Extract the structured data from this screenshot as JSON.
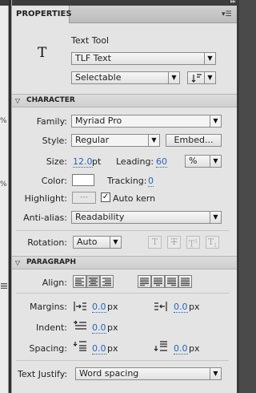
{
  "left_dock": {
    "pct1": "%",
    "pct2": "%"
  },
  "panel": {
    "tab_label": "PROPERTIES",
    "menu_icon": "panel-menu-icon"
  },
  "tool": {
    "glyph": "T",
    "name": "Text Tool",
    "text_type": "TLF Text",
    "selectability": "Selectable"
  },
  "character": {
    "title": "CHARACTER",
    "family_label": "Family:",
    "family_value": "Myriad Pro",
    "style_label": "Style:",
    "style_value": "Regular",
    "embed_label": "Embed...",
    "size_label": "Size:",
    "size_value": "12.0",
    "size_unit": "pt",
    "leading_label": "Leading:",
    "leading_value": "60",
    "leading_unit": "%",
    "color_label": "Color:",
    "color_value": "#ffffff",
    "tracking_label": "Tracking:",
    "tracking_value": "0",
    "highlight_label": "Highlight:",
    "highlight_value": "---",
    "autokern_label": "Auto kern",
    "autokern_checked": true,
    "antialias_label": "Anti-alias:",
    "antialias_value": "Readability",
    "rotation_label": "Rotation:",
    "rotation_value": "Auto",
    "style_buttons": [
      "T",
      "T",
      "T",
      "T"
    ]
  },
  "paragraph": {
    "title": "PARAGRAPH",
    "align_label": "Align:",
    "margins_label": "Margins:",
    "margin_left": "0.0",
    "margin_right": "0.0",
    "indent_label": "Indent:",
    "indent_value": "0.0",
    "spacing_label": "Spacing:",
    "space_before": "0.0",
    "space_after": "0.0",
    "unit": "px",
    "justify_label": "Text Justify:",
    "justify_value": "Word spacing"
  }
}
